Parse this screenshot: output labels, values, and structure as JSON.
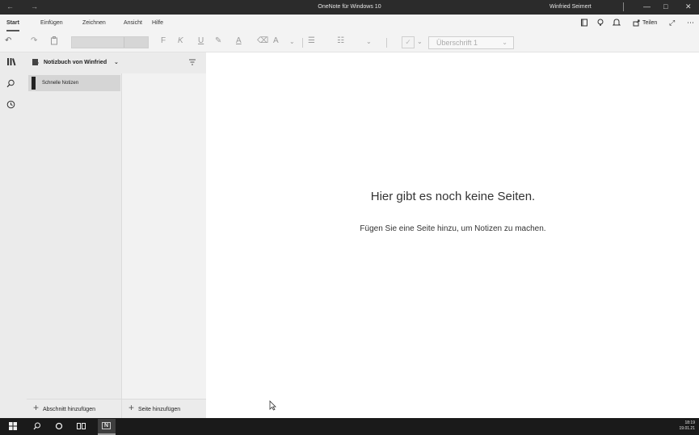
{
  "titlebar": {
    "back_icon": "arrow-left-icon",
    "forward_icon": "arrow-right-icon",
    "title": "OneNote für Windows 10",
    "user": "Winfried Seimert",
    "minimize": "—",
    "maximize": "□",
    "close": "✕"
  },
  "ribbon": {
    "tabs": [
      "Start",
      "Einfügen",
      "Zeichnen",
      "Ansicht",
      "Hilfe"
    ],
    "active_tab": "Start",
    "share_label": "Teilen",
    "icons": [
      "notebook-icon",
      "lightbulb-icon",
      "bell-icon",
      "share-icon",
      "expand-icon",
      "more-icon"
    ]
  },
  "toolbar": {
    "undo": "↶",
    "redo": "↷",
    "clipboard": "clipboard-icon",
    "bold": "F",
    "italic": "K",
    "underline": "U",
    "style_value": "Überschrift 1",
    "tag_chevron": "⌄"
  },
  "rail": {
    "icons": [
      "notebooks-icon",
      "search-icon",
      "recent-icon"
    ]
  },
  "notebook": {
    "name": "Notizbuch von Winfried",
    "sections": [
      {
        "label": "Schnelle Notizen",
        "color": "#222222"
      }
    ],
    "add_section": "Abschnitt hinzufügen",
    "add_page": "Seite hinzufügen"
  },
  "content": {
    "empty_title": "Hier gibt es noch keine Seiten.",
    "empty_subtitle": "Fügen Sie eine Seite hinzu, um Notizen zu machen."
  },
  "taskbar": {
    "app_label": "N",
    "time": "18:19",
    "date": "19.01.21"
  },
  "colors": {
    "titlebar": "#2b2b2b",
    "ribbon": "#f3f3f3",
    "panel": "#ebebeb",
    "taskbar": "#1a1a1a"
  }
}
